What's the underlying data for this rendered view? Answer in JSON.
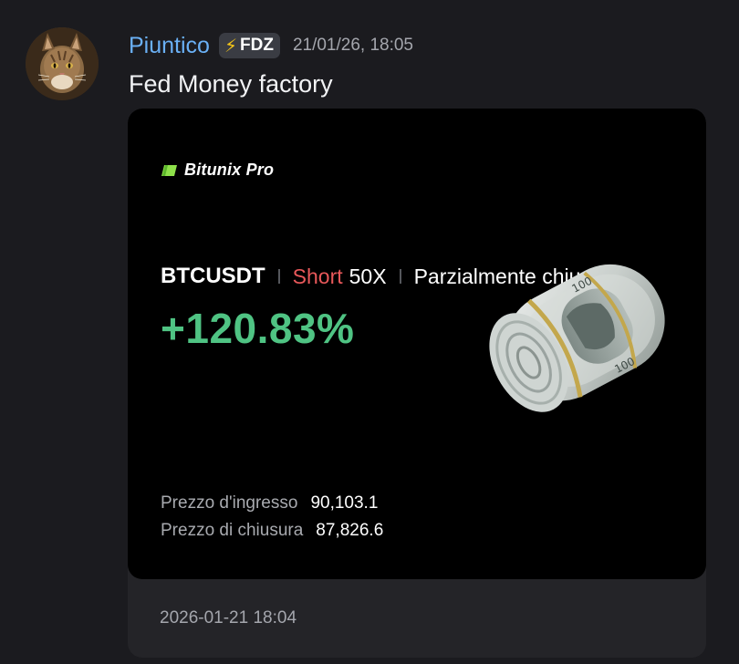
{
  "message": {
    "author": "Piuntico",
    "tag": {
      "icon": "lightning-icon",
      "label": "FDZ"
    },
    "timestamp": "21/01/26, 18:05",
    "text": "Fed Money factory"
  },
  "card": {
    "brand": "Bitunix Pro",
    "pair": "BTCUSDT",
    "side": "Short",
    "leverage": "50X",
    "status": "Parzialmente chiuso",
    "pnl": "+120.83%",
    "entry_label": "Prezzo d'ingresso",
    "entry_value": "90,103.1",
    "exit_label": "Prezzo di chiusura",
    "exit_value": "87,826.6",
    "illustration": "money-roll-icon"
  },
  "embed_footer": {
    "time": "2026-01-21 18:04"
  },
  "colors": {
    "username": "#6ab0f5",
    "short": "#e8585a",
    "profit": "#4fc383",
    "brand_accent": "#8ee04a",
    "background": "#1b1b1f",
    "card": "#000000"
  }
}
